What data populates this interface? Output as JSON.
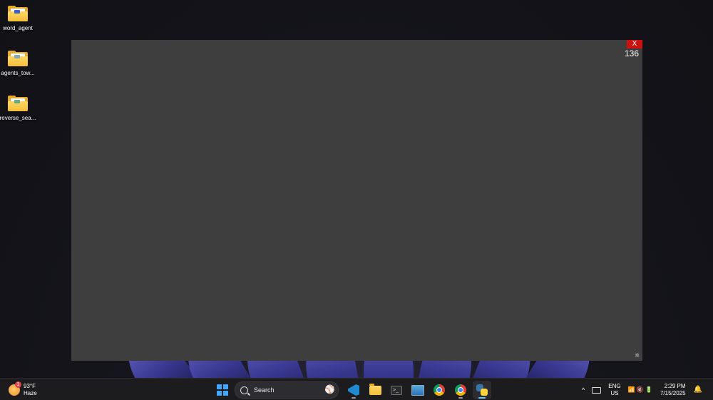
{
  "desktop": {
    "icons": [
      {
        "label": "word_agent"
      },
      {
        "label": "agents_tow..."
      },
      {
        "label": "reverse_sea..."
      }
    ]
  },
  "overlay": {
    "close_label": "X",
    "counter": "136",
    "corner_glyph": "✲"
  },
  "taskbar": {
    "weather": {
      "temp": "93°F",
      "condition": "Haze",
      "badge": "1"
    },
    "search": {
      "label": "Search"
    },
    "apps": [
      {
        "name": "Visual Studio Code",
        "icon": "vscode-icon"
      },
      {
        "name": "File Explorer",
        "icon": "folder-icon"
      },
      {
        "name": "Terminal",
        "icon": "terminal-icon"
      },
      {
        "name": "Remote Desktop",
        "icon": "monitor-icon"
      },
      {
        "name": "Google Chrome",
        "icon": "chrome-icon"
      },
      {
        "name": "Google Chrome",
        "icon": "chrome-icon"
      },
      {
        "name": "Python",
        "icon": "python-icon"
      }
    ],
    "tray": {
      "chevron": "^",
      "lang_line1": "ENG",
      "lang_line2": "US",
      "time": "2:29 PM",
      "date": "7/15/2025"
    }
  },
  "colors": {
    "overlay_bg": "#3e3e3e",
    "close_bg": "#cc1111",
    "taskbar_bg": "#1c1c1f",
    "accent": "#60cdff"
  }
}
